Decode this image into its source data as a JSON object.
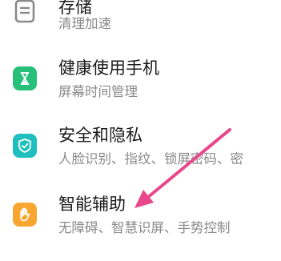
{
  "settings": {
    "items": [
      {
        "title": "存储",
        "subtitle": "清理加速",
        "icon": "storage-icon",
        "icon_color": "#8a8a8a"
      },
      {
        "title": "健康使用手机",
        "subtitle": "屏幕时间管理",
        "icon": "hourglass-icon",
        "icon_color": "#27c07a"
      },
      {
        "title": "安全和隐私",
        "subtitle": "人脸识别、指纹、锁屏密码、密",
        "icon": "shield-icon",
        "icon_color": "#1fbfbf"
      },
      {
        "title": "智能辅助",
        "subtitle": "无障碍、智慧识屏、手势控制",
        "icon": "hand-icon",
        "icon_color": "#f7a731"
      }
    ]
  },
  "annotation": {
    "arrow_color": "#e8478b"
  }
}
